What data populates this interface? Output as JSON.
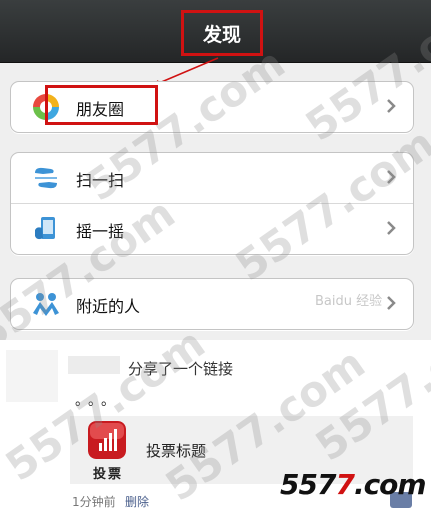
{
  "header": {
    "title": "发现"
  },
  "groups": [
    {
      "items": [
        {
          "label": "朋友圈",
          "icon": "moments-icon"
        }
      ]
    },
    {
      "items": [
        {
          "label": "扫一扫",
          "icon": "scan-icon"
        },
        {
          "label": "摇一摇",
          "icon": "shake-icon"
        }
      ]
    },
    {
      "items": [
        {
          "label": "附近的人",
          "icon": "people-nearby-icon"
        }
      ]
    }
  ],
  "watermark": "5577.com",
  "watermark_baidu": "Baidu 经验",
  "feed": {
    "post_text": "分享了一个链接",
    "dots": "。。。",
    "link_icon_caption": "投票",
    "link_title": "投票标题",
    "time": "1分钟前",
    "delete_label": "删除"
  },
  "brand": {
    "part1": "557",
    "part2": "7",
    "part3": ".com"
  },
  "colors": {
    "annotation": "#d01212",
    "header_bg": "#2a2d2e",
    "link_blue": "#4a5f8c"
  }
}
